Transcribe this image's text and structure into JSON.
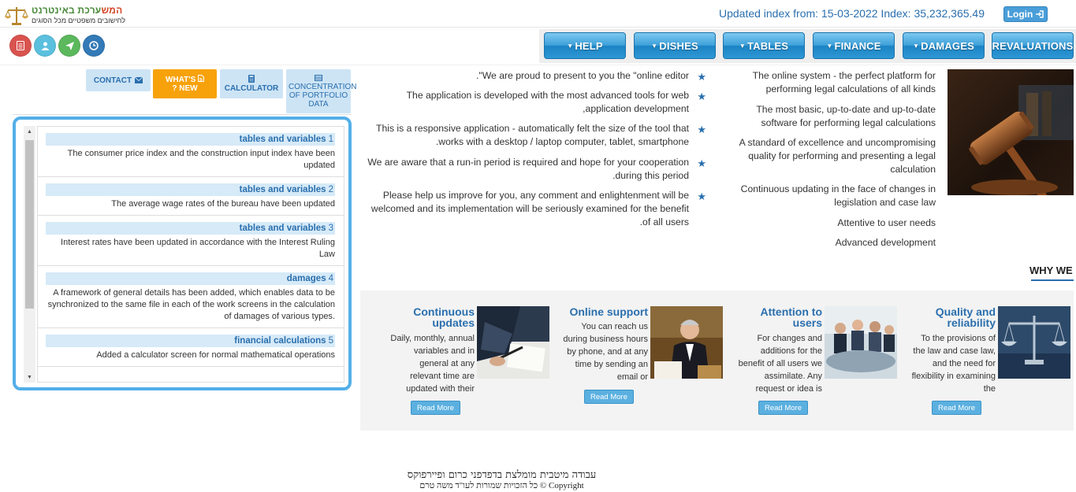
{
  "header": {
    "logo_brand_part1": "המש",
    "logo_brand_part2": "ערכת באינטרנט",
    "logo_tagline": "לחישובים משפטיים מכל הסוגים",
    "updated_index": "Updated index from: 15-03-2022 Index: 35,232,365.49",
    "login_label": "Login",
    "login_icon": "sign-in-icon"
  },
  "quick_icons": [
    {
      "name": "list-icon",
      "color": "#d9534f"
    },
    {
      "name": "user-icon",
      "color": "#5bc0de"
    },
    {
      "name": "send-icon",
      "color": "#5cb85c"
    },
    {
      "name": "clock-icon",
      "color": "#337ab7"
    }
  ],
  "nav": [
    {
      "label": "HELP",
      "has_caret": true
    },
    {
      "label": "DISHES",
      "has_caret": true
    },
    {
      "label": "TABLES",
      "has_caret": true
    },
    {
      "label": "FINANCE",
      "has_caret": true
    },
    {
      "label": "DAMAGES",
      "has_caret": true
    },
    {
      "label": "REVALUATIONS",
      "has_caret": false
    }
  ],
  "tabs": {
    "contact": "CONTACT",
    "whats_new_line1": "WHAT'S",
    "whats_new_line2": "? NEW",
    "calculator": "CALCULATOR",
    "concentration": "CONCENTRATION OF PORTFOLIO DATA"
  },
  "news": [
    {
      "num": "1",
      "title": "tables and variables",
      "text": "The consumer price index and the construction input index have been updated"
    },
    {
      "num": "2",
      "title": "tables and variables",
      "text": "The average wage rates of the bureau have been updated"
    },
    {
      "num": "3",
      "title": "tables and variables",
      "text": "Interest rates have been updated in accordance with the Interest Ruling Law"
    },
    {
      "num": "4",
      "title": "damages",
      "text": "A framework of general details has been added, which enables data to be synchronized to the same file in each of the work screens in the calculation of damages of various types."
    },
    {
      "num": "5",
      "title": "financial calculations",
      "text": "Added a calculator screen for normal mathematical operations"
    }
  ],
  "features": [
    ".\"We are proud to present to you the \"online editor",
    "The application is developed with the most advanced tools for web ,application development",
    "This is a responsive application - automatically felt the size of the tool that .works with a desktop / laptop computer, tablet, smartphone",
    "We are aware that a run-in period is required and hope for your cooperation .during this period",
    "Please help us improve for you, any comment and enlightenment will be welcomed and its implementation will be seriously examined for the benefit .of all users"
  ],
  "right_features": [
    "The online system - the perfect platform for performing legal calculations of all kinds",
    "The most basic, up-to-date and up-to-date software for performing legal calculations",
    "A standard of excellence and uncompromising quality for performing and presenting a legal calculation",
    "Continuous updating in the face of changes in legislation and case law",
    "Attentive to user needs",
    "Advanced development"
  ],
  "why_we": "WHY WE",
  "cards": [
    {
      "title": "Continuous updates",
      "text": "Daily, monthly, annual variables and in general at any relevant time are updated with their",
      "image": "document-signing-photo",
      "read_more": "Read More"
    },
    {
      "title": "Online support",
      "text": "You can reach us during business hours by phone, and at any time by sending an email or",
      "image": "support-agent-photo",
      "read_more": "Read More"
    },
    {
      "title": "Attention to users",
      "text": "For changes and additions for the benefit of all users we assimilate. Any request or idea is",
      "image": "meeting-photo",
      "read_more": "Read More"
    },
    {
      "title": "Quality and reliability",
      "text": "To the provisions of the law and case law, and the need for flexibility in examining the",
      "image": "scales-photo",
      "read_more": "Read More"
    }
  ],
  "footer": {
    "line1": "עבודה מיטבית מומלצת בדפדפני כרום ופיירפוקס",
    "line2": "כל הזכויות שמורות לעו\"ד משה טרם © Copyright"
  }
}
